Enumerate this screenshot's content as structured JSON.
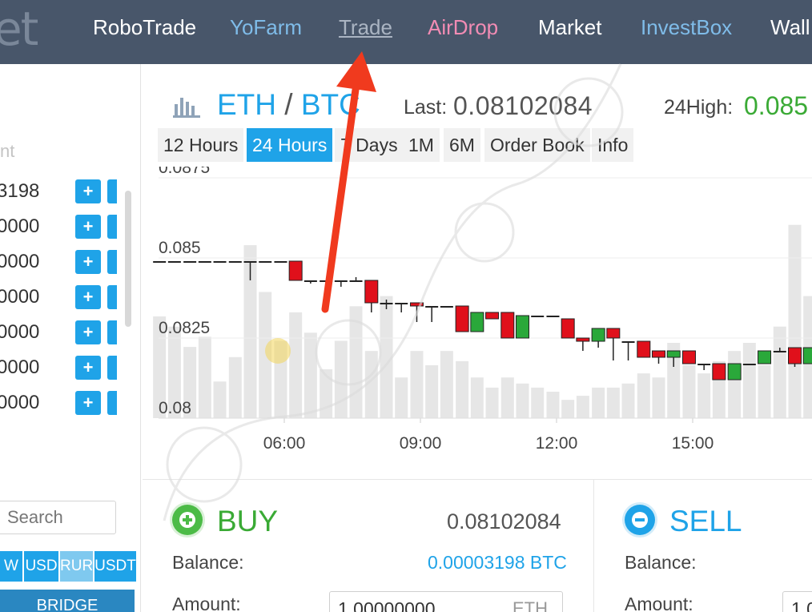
{
  "nav": {
    "logo_text": "et",
    "items": [
      {
        "label": "RoboTrade"
      },
      {
        "label": "YoFarm"
      },
      {
        "label": "Trade"
      },
      {
        "label": "AirDrop"
      },
      {
        "label": "Market"
      },
      {
        "label": "InvestBox"
      },
      {
        "label": "Wall"
      }
    ]
  },
  "sidebar": {
    "column_header": "nt",
    "rows": [
      {
        "value": "3198",
        "add": "+"
      },
      {
        "value": "0000",
        "add": "+"
      },
      {
        "value": "0000",
        "add": "+"
      },
      {
        "value": "0000",
        "add": "+"
      },
      {
        "value": "0000",
        "add": "+"
      },
      {
        "value": "0000",
        "add": "+"
      },
      {
        "value": "0000",
        "add": "+"
      }
    ],
    "search_placeholder": "Search",
    "currency_tabs": [
      "W",
      "USD",
      "RUR",
      "USDT"
    ],
    "bridge_label": "BRIDGE"
  },
  "chart_header": {
    "base": "ETH",
    "slash": "/",
    "quote": "BTC",
    "last_label": "Last:",
    "last_value": "0.08102084",
    "high_label": "24High:",
    "high_value": "0.085"
  },
  "ranges": [
    "12 Hours",
    "24 Hours",
    "7 Days",
    "1M",
    "6M",
    "Order Book",
    "Info"
  ],
  "active_range": "24 Hours",
  "colors": {
    "up": "#2aa83a",
    "down": "#e0101b",
    "accent": "#1fa3e8",
    "volume": "#e6e6e6"
  },
  "chart_data": {
    "type": "candlestick",
    "y_ticks": [
      "0.0875",
      "0.085",
      "0.0825",
      "0.08"
    ],
    "ylim": [
      0.08,
      0.0875
    ],
    "x_ticks": [
      "06:00",
      "09:00",
      "12:00",
      "15:00"
    ],
    "x_tick_positions": [
      5.5,
      8.5,
      11.5,
      14.5
    ],
    "xlim": [
      2.5,
      17.0
    ],
    "candles": [
      {
        "x": 2.75,
        "o": 0.0849,
        "c": 0.0849,
        "h": 0.0849,
        "l": 0.0849,
        "vol": 0.5
      },
      {
        "x": 3.08,
        "o": 0.0849,
        "c": 0.0849,
        "h": 0.0849,
        "l": 0.0849,
        "vol": 0.45
      },
      {
        "x": 3.42,
        "o": 0.0849,
        "c": 0.0849,
        "h": 0.0849,
        "l": 0.0849,
        "vol": 0.35
      },
      {
        "x": 3.75,
        "o": 0.0849,
        "c": 0.0849,
        "h": 0.0849,
        "l": 0.0849,
        "vol": 0.4
      },
      {
        "x": 4.08,
        "o": 0.0849,
        "c": 0.0849,
        "h": 0.0849,
        "l": 0.0849,
        "vol": 0.18
      },
      {
        "x": 4.42,
        "o": 0.0849,
        "c": 0.0849,
        "h": 0.0849,
        "l": 0.0849,
        "vol": 0.3
      },
      {
        "x": 4.75,
        "o": 0.0849,
        "c": 0.0849,
        "h": 0.0849,
        "l": 0.0843,
        "vol": 0.85
      },
      {
        "x": 5.08,
        "o": 0.0849,
        "c": 0.0849,
        "h": 0.0849,
        "l": 0.0849,
        "vol": 0.62
      },
      {
        "x": 5.42,
        "o": 0.0849,
        "c": 0.0849,
        "h": 0.0849,
        "l": 0.0849,
        "vol": 0.38
      },
      {
        "x": 5.75,
        "o": 0.0849,
        "c": 0.0843,
        "h": 0.0849,
        "l": 0.0843,
        "vol": 0.52
      },
      {
        "x": 6.08,
        "o": 0.0843,
        "c": 0.0843,
        "h": 0.0843,
        "l": 0.0842,
        "vol": 0.42
      },
      {
        "x": 6.42,
        "o": 0.0843,
        "c": 0.0843,
        "h": 0.0843,
        "l": 0.0843,
        "vol": 0.24
      },
      {
        "x": 6.75,
        "o": 0.0843,
        "c": 0.0843,
        "h": 0.0843,
        "l": 0.0841,
        "vol": 0.38
      },
      {
        "x": 7.08,
        "o": 0.0843,
        "c": 0.0843,
        "h": 0.0844,
        "l": 0.0843,
        "vol": 0.55
      },
      {
        "x": 7.42,
        "o": 0.0843,
        "c": 0.0836,
        "h": 0.0843,
        "l": 0.0833,
        "vol": 0.33
      },
      {
        "x": 7.75,
        "o": 0.0836,
        "c": 0.0836,
        "h": 0.0837,
        "l": 0.0834,
        "vol": 0.6
      },
      {
        "x": 8.08,
        "o": 0.0836,
        "c": 0.0836,
        "h": 0.0836,
        "l": 0.0833,
        "vol": 0.2
      },
      {
        "x": 8.42,
        "o": 0.0836,
        "c": 0.0835,
        "h": 0.0836,
        "l": 0.083,
        "vol": 0.33
      },
      {
        "x": 8.75,
        "o": 0.0835,
        "c": 0.0835,
        "h": 0.0835,
        "l": 0.083,
        "vol": 0.26
      },
      {
        "x": 9.08,
        "o": 0.0835,
        "c": 0.0835,
        "h": 0.0835,
        "l": 0.0835,
        "vol": 0.33
      },
      {
        "x": 9.42,
        "o": 0.0835,
        "c": 0.0827,
        "h": 0.0835,
        "l": 0.0827,
        "vol": 0.28
      },
      {
        "x": 9.75,
        "o": 0.0827,
        "c": 0.0833,
        "h": 0.0833,
        "l": 0.0827,
        "vol": 0.2
      },
      {
        "x": 10.08,
        "o": 0.0833,
        "c": 0.0831,
        "h": 0.0833,
        "l": 0.0831,
        "vol": 0.15
      },
      {
        "x": 10.42,
        "o": 0.0833,
        "c": 0.0825,
        "h": 0.0833,
        "l": 0.0825,
        "vol": 0.2
      },
      {
        "x": 10.75,
        "o": 0.0825,
        "c": 0.0832,
        "h": 0.0832,
        "l": 0.0825,
        "vol": 0.17
      },
      {
        "x": 11.08,
        "o": 0.0832,
        "c": 0.0832,
        "h": 0.0832,
        "l": 0.0832,
        "vol": 0.15
      },
      {
        "x": 11.42,
        "o": 0.0832,
        "c": 0.0832,
        "h": 0.0832,
        "l": 0.0832,
        "vol": 0.13
      },
      {
        "x": 11.75,
        "o": 0.0831,
        "c": 0.0825,
        "h": 0.0831,
        "l": 0.0825,
        "vol": 0.09
      },
      {
        "x": 12.08,
        "o": 0.0825,
        "c": 0.0824,
        "h": 0.0825,
        "l": 0.0821,
        "vol": 0.11
      },
      {
        "x": 12.42,
        "o": 0.0824,
        "c": 0.0828,
        "h": 0.0828,
        "l": 0.0822,
        "vol": 0.15
      },
      {
        "x": 12.75,
        "o": 0.0828,
        "c": 0.0825,
        "h": 0.0828,
        "l": 0.0818,
        "vol": 0.15
      },
      {
        "x": 13.08,
        "o": 0.0824,
        "c": 0.0824,
        "h": 0.0824,
        "l": 0.0818,
        "vol": 0.17
      },
      {
        "x": 13.42,
        "o": 0.0824,
        "c": 0.0819,
        "h": 0.0824,
        "l": 0.0819,
        "vol": 0.22
      },
      {
        "x": 13.75,
        "o": 0.0821,
        "c": 0.0819,
        "h": 0.0821,
        "l": 0.0817,
        "vol": 0.2
      },
      {
        "x": 14.08,
        "o": 0.0819,
        "c": 0.0821,
        "h": 0.0821,
        "l": 0.0816,
        "vol": 0.37
      },
      {
        "x": 14.42,
        "o": 0.0821,
        "c": 0.0817,
        "h": 0.0821,
        "l": 0.0817,
        "vol": 0.26
      },
      {
        "x": 14.75,
        "o": 0.0817,
        "c": 0.0817,
        "h": 0.0817,
        "l": 0.0815,
        "vol": 0.22
      },
      {
        "x": 15.08,
        "o": 0.0817,
        "c": 0.0812,
        "h": 0.0817,
        "l": 0.0812,
        "vol": 0.28
      },
      {
        "x": 15.42,
        "o": 0.0812,
        "c": 0.0817,
        "h": 0.0817,
        "l": 0.0812,
        "vol": 0.33
      },
      {
        "x": 15.75,
        "o": 0.0817,
        "c": 0.0817,
        "h": 0.0817,
        "l": 0.0817,
        "vol": 0.37
      },
      {
        "x": 16.08,
        "o": 0.0817,
        "c": 0.0821,
        "h": 0.0821,
        "l": 0.0817,
        "vol": 0.26
      },
      {
        "x": 16.42,
        "o": 0.0821,
        "c": 0.0821,
        "h": 0.0822,
        "l": 0.0821,
        "vol": 0.45
      },
      {
        "x": 16.75,
        "o": 0.0822,
        "c": 0.0817,
        "h": 0.0822,
        "l": 0.0816,
        "vol": 0.95
      },
      {
        "x": 17.08,
        "o": 0.0817,
        "c": 0.0822,
        "h": 0.0822,
        "l": 0.0817,
        "vol": 0.6
      }
    ]
  },
  "buy": {
    "title": "BUY",
    "price": "0.08102084",
    "balance_label": "Balance:",
    "balance_value": "0.00003198 BTC",
    "amount_label": "Amount:",
    "amount_value": "1.00000000",
    "amount_unit": "ETH"
  },
  "sell": {
    "title": "SELL",
    "balance_label": "Balance:",
    "amount_label": "Amount:",
    "amount_value": "1.0"
  }
}
